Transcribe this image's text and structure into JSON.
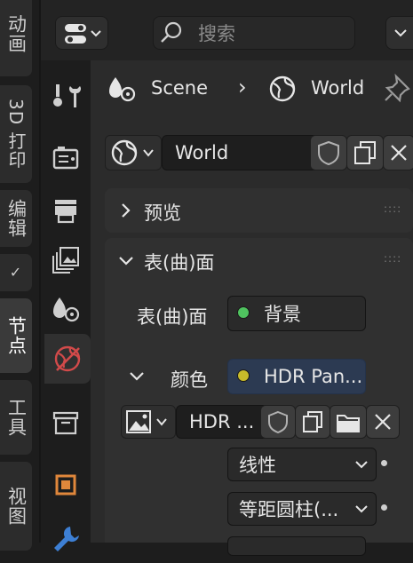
{
  "vertical_tabs": [
    {
      "label": "动画"
    },
    {
      "label": "3D 打印"
    },
    {
      "label": "编辑"
    },
    {
      "label": "✓"
    },
    {
      "label": "节点"
    },
    {
      "label": "工具"
    },
    {
      "label": "视图"
    }
  ],
  "header": {
    "search_placeholder": "搜索"
  },
  "breadcrumb": {
    "scene": "Scene",
    "separator": "›",
    "world": "World"
  },
  "datablock": {
    "name": "World"
  },
  "panels": {
    "preview": {
      "title": "预览"
    },
    "surface": {
      "title": "表(曲)面",
      "surface_label": "表(曲)面",
      "surface_value": "背景",
      "surface_dot_color": "#4fc35f",
      "color_label": "颜色",
      "color_value": "HDR Pan...",
      "color_dot_color": "#c8bb2a",
      "image_name": "HDR ...",
      "interpolation": "线性",
      "projection": "等距圆柱(..."
    }
  },
  "colors": {
    "accent_world": "#d24a4a",
    "modifier_orange": "#e0873b",
    "wrench_blue": "#3d7fd4"
  }
}
